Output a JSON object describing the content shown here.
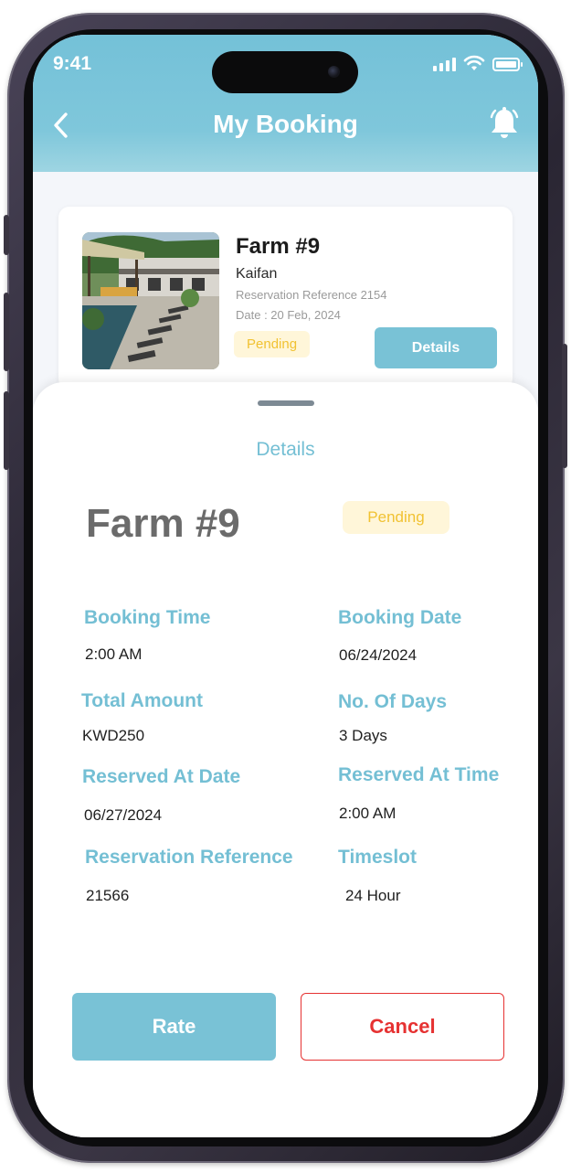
{
  "status_bar": {
    "time": "9:41"
  },
  "header": {
    "title": "My Booking"
  },
  "booking_card": {
    "name": "Farm #9",
    "location": "Kaifan",
    "reservation_reference": "Reservation Reference 2154",
    "date": "Date : 20 Feb, 2024",
    "status": "Pending",
    "details_label": "Details"
  },
  "details_sheet": {
    "title": "Details",
    "farm_name": "Farm #9",
    "status": "Pending",
    "fields": {
      "booking_time": {
        "label": "Booking Time",
        "value": "2:00 AM"
      },
      "booking_date": {
        "label": "Booking Date",
        "value": "06/24/2024"
      },
      "total_amount": {
        "label": "Total Amount",
        "value": "KWD250"
      },
      "no_of_days": {
        "label": "No. Of Days",
        "value": "3 Days"
      },
      "reserved_at_date": {
        "label": "Reserved At Date",
        "value": "06/27/2024"
      },
      "reserved_at_time": {
        "label": "Reserved At Time",
        "value": "2:00 AM"
      },
      "reservation_reference": {
        "label": "Reservation Reference",
        "value": "21566"
      },
      "timeslot": {
        "label": "Timeslot",
        "value": "24 Hour"
      }
    },
    "rate_label": "Rate",
    "cancel_label": "Cancel"
  },
  "colors": {
    "accent": "#79c2d6",
    "pending_bg": "#fff6d9",
    "pending_text": "#f1c232",
    "cancel": "#e63232"
  },
  "icons": {
    "back": "chevron-left-icon",
    "notifications": "bell-icon"
  }
}
